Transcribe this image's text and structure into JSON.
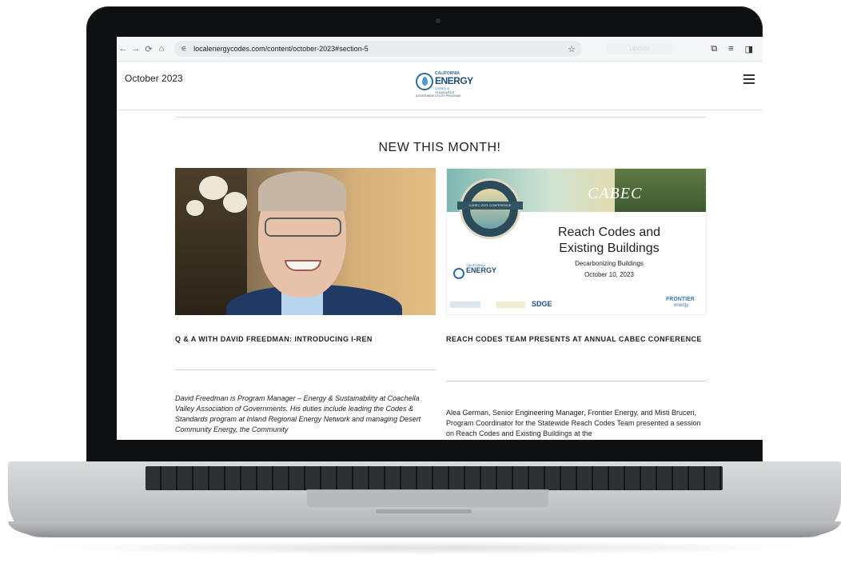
{
  "browser": {
    "url": "localenergycodes.com/content/october-2023#section-5",
    "tab_label_faded": "Update"
  },
  "site": {
    "issue_label": "October 2023",
    "logo": {
      "line1": "CALIFORNIA",
      "line2": "ENERGY",
      "line3": "CODES & STANDARDS",
      "line4": "A STATEWIDE UTILITY PROGRAM"
    }
  },
  "section": {
    "title": "NEW THIS MONTH!"
  },
  "cards": [
    {
      "title": "Q & A WITH DAVID FREEDMAN: INTRODUCING I-REN",
      "body": "David Freedman is Program Manager – Energy & Sustainability at Coachella Valley Association of Governments. His duties include leading the Codes & Standards program at Inland Regional Energy Network and managing Desert Community Energy, the Community"
    },
    {
      "title": "REACH CODES TEAM PRESENTS AT ANNUAL CABEC CONFERENCE",
      "body": "Alea German, Senior Engineering Manager, Frontier Energy, and Misti Bruceri, Program Coordinator for the Statewide Reach Codes Team presented a session on Reach Codes and Existing Buildings at the"
    }
  ],
  "flyer": {
    "brand": "CABEC",
    "badge_text": "CABEC 2023 CONFERENCE",
    "heading_line1": "Reach Codes and",
    "heading_line2": "Existing Buildings",
    "subheading": "Decarbonizing Buildings",
    "date": "October 10, 2023",
    "logo_top": "CALIFORNIA",
    "logo_main": "ENERGY",
    "sponsor_sdge": "SDGE",
    "sponsor_frontier": "FRONTIER",
    "sponsor_frontier_sub": "energy"
  }
}
